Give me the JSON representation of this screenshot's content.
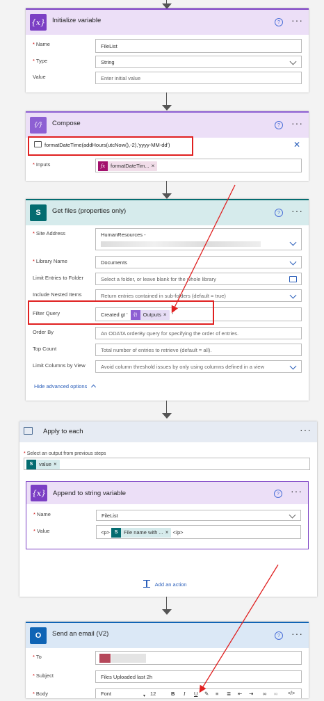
{
  "colors": {
    "variable": "#7b3fc4",
    "compose": "#8d5fd3",
    "sharepoint": "#036c70",
    "loop": "#486991",
    "outlook": "#0f64b5",
    "accent_link": "#2b5fba",
    "highlight_red": "#e02020"
  },
  "icons": {
    "variable": "curly-braces-x-icon",
    "compose": "curly-braces-icon",
    "sharepoint": "sharepoint-icon",
    "loop": "loop-icon",
    "outlook": "outlook-icon"
  },
  "init_variable": {
    "title": "Initialize variable",
    "help": "?",
    "more": "···",
    "name_label": "Name",
    "name_value": "FileList",
    "type_label": "Type",
    "type_value": "String",
    "value_label": "Value",
    "value_placeholder": "Enter initial value"
  },
  "compose": {
    "title": "Compose",
    "help": "?",
    "more": "···",
    "expression": "formatDateTime(addHours(utcNow(),-2),'yyyy-MM-dd')",
    "close": "✕",
    "inputs_label": "Inputs",
    "inputs_token": "formatDateTim...",
    "token_x": "×"
  },
  "get_files": {
    "title": "Get files (properties only)",
    "help": "?",
    "more": "···",
    "site_label": "Site Address",
    "site_value": "HumanResources -",
    "library_label": "Library Name",
    "library_value": "Documents",
    "limit_label": "Limit Entries to Folder",
    "limit_placeholder": "Select a folder, or leave blank for the whole library",
    "nested_label": "Include Nested Items",
    "nested_placeholder": "Return entries contained in sub-folders (default = true)",
    "filter_label": "Filter Query",
    "filter_prefix": "Created gt '",
    "filter_token": "Outputs",
    "filter_suffix": "'",
    "token_x": "×",
    "order_label": "Order By",
    "order_placeholder": "An ODATA orderBy query for specifying the order of entries.",
    "top_label": "Top Count",
    "top_placeholder": "Total number of entries to retrieve (default = all).",
    "columns_label": "Limit Columns by View",
    "columns_placeholder": "Avoid column threshold issues by only using columns defined in a view",
    "hide_advanced": "Hide advanced options"
  },
  "apply_each": {
    "title": "Apply to each",
    "more": "···",
    "select_label": "Select an output from previous steps",
    "token": "value",
    "token_x": "×",
    "add_action": "Add an action"
  },
  "append": {
    "title": "Append to string variable",
    "help": "?",
    "more": "···",
    "name_label": "Name",
    "name_value": "FileList",
    "value_label": "Value",
    "value_prefix": "<p>",
    "value_token": "File name with ...",
    "value_suffix": "</p>",
    "token_x": "×"
  },
  "send_email": {
    "title": "Send an email (V2)",
    "help": "?",
    "more": "···",
    "to_label": "To",
    "subject_label": "Subject",
    "subject_value": "Files Uploaded last 2h",
    "body_label": "Body",
    "font_value": "Font",
    "size_value": "12"
  }
}
